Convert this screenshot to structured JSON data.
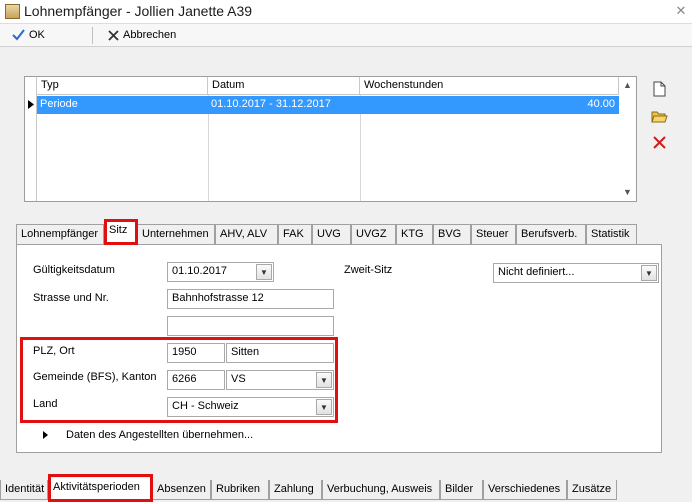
{
  "window": {
    "title": "Lohnempfänger - Jollien Janette A39",
    "close_glyph": "✕"
  },
  "toolbar": {
    "ok_label": "OK",
    "cancel_label": "Abbrechen"
  },
  "grid": {
    "columns": [
      "Typ",
      "Datum",
      "Wochenstunden"
    ],
    "rows": [
      {
        "typ": "Periode",
        "datum": "01.10.2017 - 31.12.2017",
        "wochenstunden": "40.00"
      }
    ]
  },
  "side_icons": [
    "new-document-icon",
    "open-folder-icon",
    "delete-icon"
  ],
  "tabs_upper": [
    "Lohnempfänger",
    "Sitz",
    "Unternehmen",
    "AHV, ALV",
    "FAK",
    "UVG",
    "UVGZ",
    "KTG",
    "BVG",
    "Steuer",
    "Berufsverb.",
    "Statistik"
  ],
  "tabs_upper_active": "Sitz",
  "form": {
    "gueltigkeitsdatum_label": "Gültigkeitsdatum",
    "gueltigkeitsdatum_value": "01.10.2017",
    "zweit_sitz_label": "Zweit-Sitz",
    "zweit_sitz_value": "Nicht definiert...",
    "strasse_label": "Strasse und Nr.",
    "strasse_value": "Bahnhofstrasse 12",
    "strasse2_value": "",
    "plz_ort_label": "PLZ, Ort",
    "plz_value": "1950",
    "ort_value": "Sitten",
    "gemeinde_label": "Gemeinde (BFS), Kanton",
    "gemeinde_value": "6266",
    "kanton_value": "VS",
    "land_label": "Land",
    "land_value": "CH - Schweiz",
    "daten_link": "Daten des Angestellten übernehmen..."
  },
  "tabs_lower": [
    "Identität",
    "Aktivitätsperioden",
    "Absenzen",
    "Rubriken",
    "Zahlung",
    "Verbuchung, Ausweis",
    "Bilder",
    "Verschiedenes",
    "Zusätze"
  ],
  "tabs_lower_active": "Aktivitätsperioden",
  "colors": {
    "selection": "#3399ff",
    "highlight": "#e01010",
    "check": "#2a6bc9",
    "delete": "#d21c1c"
  }
}
